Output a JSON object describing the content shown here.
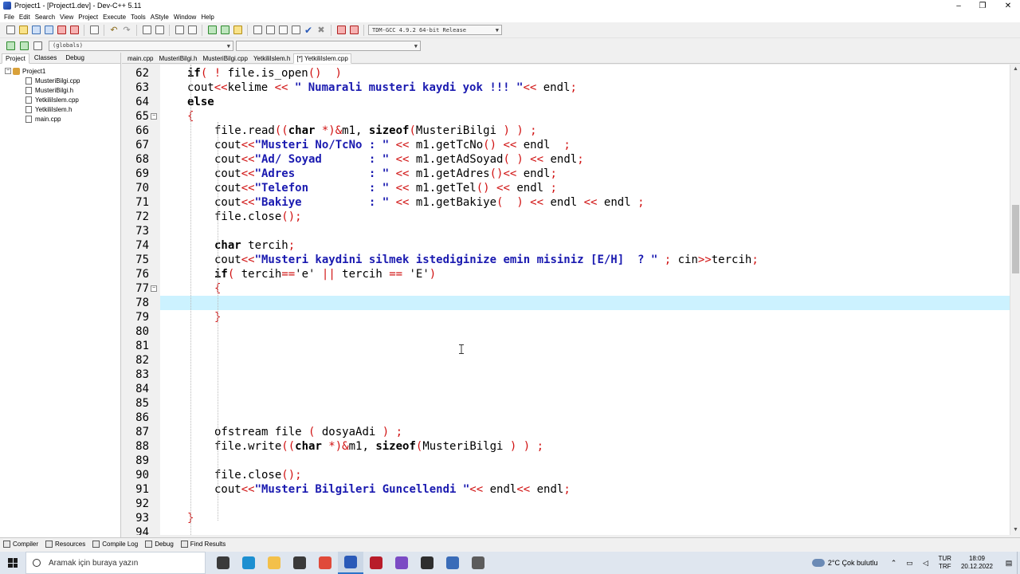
{
  "window": {
    "title": "Project1 - [Project1.dev] - Dev-C++ 5.11",
    "controls": {
      "minimize": "–",
      "maximize": "❐",
      "close": "✕"
    }
  },
  "menu": [
    "File",
    "Edit",
    "Search",
    "View",
    "Project",
    "Execute",
    "Tools",
    "AStyle",
    "Window",
    "Help"
  ],
  "toolbar": {
    "compiler_select": "TDM-GCC 4.9.2 64-bit Release",
    "scope_select": "(globals)",
    "members_select": ""
  },
  "left_panel": {
    "tabs": [
      "Project",
      "Classes",
      "Debug"
    ],
    "active_tab": "Project",
    "project_name": "Project1",
    "files": [
      "MusteriBilgi.cpp",
      "MusteriBilgi.h",
      "YetkiliIslem.cpp",
      "YetkiliIslem.h",
      "main.cpp"
    ]
  },
  "editor_tabs": [
    {
      "label": "main.cpp",
      "active": false
    },
    {
      "label": "MusteriBilgi.h",
      "active": false
    },
    {
      "label": "MusteriBilgi.cpp",
      "active": false
    },
    {
      "label": "YetkiliIslem.h",
      "active": false
    },
    {
      "label": "[*] YetkiliIslem.cpp",
      "active": true
    }
  ],
  "editor": {
    "current_line": 78,
    "lines": [
      {
        "n": "62",
        "indent": 1,
        "tokens": [
          [
            "kw",
            "if"
          ],
          [
            "sym",
            "( "
          ],
          [
            "sym",
            "!"
          ],
          [
            "plain",
            " file.is_open"
          ],
          [
            "sym",
            "()  )"
          ]
        ]
      },
      {
        "n": "63",
        "indent": 1,
        "tokens": [
          [
            "plain",
            "cout"
          ],
          [
            "sym",
            "<<"
          ],
          [
            "plain",
            "kelime "
          ],
          [
            "sym",
            "<<"
          ],
          [
            "str",
            " \" Numarali musteri kaydi yok !!! \""
          ],
          [
            "sym",
            "<<"
          ],
          [
            "plain",
            " endl"
          ],
          [
            "sym",
            ";"
          ]
        ]
      },
      {
        "n": "64",
        "indent": 1,
        "tokens": [
          [
            "kw",
            "else"
          ]
        ]
      },
      {
        "n": "65",
        "indent": 1,
        "fold": true,
        "tokens": [
          [
            "sym",
            "{"
          ]
        ]
      },
      {
        "n": "66",
        "indent": 2,
        "tokens": [
          [
            "plain",
            "file.read"
          ],
          [
            "sym",
            "(("
          ],
          [
            "kw",
            "char"
          ],
          [
            "sym",
            " *)&"
          ],
          [
            "plain",
            "m1, "
          ],
          [
            "kw",
            "sizeof"
          ],
          [
            "sym",
            "("
          ],
          [
            "plain",
            "MusteriBilgi "
          ],
          [
            "sym",
            ") ) ;"
          ]
        ]
      },
      {
        "n": "67",
        "indent": 2,
        "tokens": [
          [
            "plain",
            "cout"
          ],
          [
            "sym",
            "<<"
          ],
          [
            "str",
            "\"Musteri No/TcNo : \""
          ],
          [
            "sym",
            " <<"
          ],
          [
            "plain",
            " m1.getTcNo"
          ],
          [
            "sym",
            "() <<"
          ],
          [
            "plain",
            " endl  "
          ],
          [
            "sym",
            ";"
          ]
        ]
      },
      {
        "n": "68",
        "indent": 2,
        "tokens": [
          [
            "plain",
            "cout"
          ],
          [
            "sym",
            "<<"
          ],
          [
            "str",
            "\"Ad/ Soyad       : \""
          ],
          [
            "sym",
            " <<"
          ],
          [
            "plain",
            " m1.getAdSoyad"
          ],
          [
            "sym",
            "( ) <<"
          ],
          [
            "plain",
            " endl"
          ],
          [
            "sym",
            ";"
          ]
        ]
      },
      {
        "n": "69",
        "indent": 2,
        "tokens": [
          [
            "plain",
            "cout"
          ],
          [
            "sym",
            "<<"
          ],
          [
            "str",
            "\"Adres           : \""
          ],
          [
            "sym",
            " <<"
          ],
          [
            "plain",
            " m1.getAdres"
          ],
          [
            "sym",
            "()<<"
          ],
          [
            "plain",
            " endl"
          ],
          [
            "sym",
            ";"
          ]
        ]
      },
      {
        "n": "70",
        "indent": 2,
        "tokens": [
          [
            "plain",
            "cout"
          ],
          [
            "sym",
            "<<"
          ],
          [
            "str",
            "\"Telefon         : \""
          ],
          [
            "sym",
            " <<"
          ],
          [
            "plain",
            " m1.getTel"
          ],
          [
            "sym",
            "() <<"
          ],
          [
            "plain",
            " endl "
          ],
          [
            "sym",
            ";"
          ]
        ]
      },
      {
        "n": "71",
        "indent": 2,
        "tokens": [
          [
            "plain",
            "cout"
          ],
          [
            "sym",
            "<<"
          ],
          [
            "str",
            "\"Bakiye          : \""
          ],
          [
            "sym",
            " <<"
          ],
          [
            "plain",
            " m1.getBakiye"
          ],
          [
            "sym",
            "(  ) <<"
          ],
          [
            "plain",
            " endl "
          ],
          [
            "sym",
            "<<"
          ],
          [
            "plain",
            " endl "
          ],
          [
            "sym",
            ";"
          ]
        ]
      },
      {
        "n": "72",
        "indent": 2,
        "tokens": [
          [
            "plain",
            "file.close"
          ],
          [
            "sym",
            "();"
          ]
        ]
      },
      {
        "n": "73",
        "indent": 2,
        "tokens": []
      },
      {
        "n": "74",
        "indent": 2,
        "tokens": [
          [
            "kw",
            "char"
          ],
          [
            "plain",
            " tercih"
          ],
          [
            "sym",
            ";"
          ]
        ]
      },
      {
        "n": "75",
        "indent": 2,
        "tokens": [
          [
            "plain",
            "cout"
          ],
          [
            "sym",
            "<<"
          ],
          [
            "str",
            "\"Musteri kaydini silmek istediginize emin misiniz [E/H]  ? \""
          ],
          [
            "sym",
            " ;"
          ],
          [
            "plain",
            " cin"
          ],
          [
            "sym",
            ">>"
          ],
          [
            "plain",
            "tercih"
          ],
          [
            "sym",
            ";"
          ]
        ]
      },
      {
        "n": "76",
        "indent": 2,
        "tokens": [
          [
            "kw",
            "if"
          ],
          [
            "sym",
            "("
          ],
          [
            "plain",
            " tercih"
          ],
          [
            "sym",
            "=="
          ],
          [
            "plain",
            "'e' "
          ],
          [
            "sym",
            "||"
          ],
          [
            "plain",
            " tercih "
          ],
          [
            "sym",
            "=="
          ],
          [
            "plain",
            " 'E'"
          ],
          [
            "sym",
            ")"
          ]
        ]
      },
      {
        "n": "77",
        "indent": 2,
        "fold": true,
        "tokens": [
          [
            "sym",
            "{"
          ]
        ]
      },
      {
        "n": "78",
        "indent": 2,
        "tokens": []
      },
      {
        "n": "79",
        "indent": 2,
        "tokens": [
          [
            "sym",
            "}"
          ]
        ]
      },
      {
        "n": "80",
        "indent": 2,
        "tokens": []
      },
      {
        "n": "81",
        "indent": 2,
        "tokens": []
      },
      {
        "n": "82",
        "indent": 2,
        "tokens": []
      },
      {
        "n": "83",
        "indent": 2,
        "tokens": []
      },
      {
        "n": "84",
        "indent": 2,
        "tokens": []
      },
      {
        "n": "85",
        "indent": 2,
        "tokens": []
      },
      {
        "n": "86",
        "indent": 2,
        "tokens": []
      },
      {
        "n": "87",
        "indent": 2,
        "tokens": [
          [
            "plain",
            "ofstream file "
          ],
          [
            "sym",
            "("
          ],
          [
            "plain",
            " dosyaAdi "
          ],
          [
            "sym",
            ") ;"
          ]
        ]
      },
      {
        "n": "88",
        "indent": 2,
        "tokens": [
          [
            "plain",
            "file.write"
          ],
          [
            "sym",
            "(("
          ],
          [
            "kw",
            "char"
          ],
          [
            "sym",
            " *)&"
          ],
          [
            "plain",
            "m1, "
          ],
          [
            "kw",
            "sizeof"
          ],
          [
            "sym",
            "("
          ],
          [
            "plain",
            "MusteriBilgi "
          ],
          [
            "sym",
            ") ) ;"
          ]
        ]
      },
      {
        "n": "89",
        "indent": 2,
        "tokens": []
      },
      {
        "n": "90",
        "indent": 2,
        "tokens": [
          [
            "plain",
            "file.close"
          ],
          [
            "sym",
            "();"
          ]
        ]
      },
      {
        "n": "91",
        "indent": 2,
        "tokens": [
          [
            "plain",
            "cout"
          ],
          [
            "sym",
            "<<"
          ],
          [
            "str",
            "\"Musteri Bilgileri Guncellendi \""
          ],
          [
            "sym",
            "<<"
          ],
          [
            "plain",
            " endl"
          ],
          [
            "sym",
            "<<"
          ],
          [
            "plain",
            " endl"
          ],
          [
            "sym",
            ";"
          ]
        ]
      },
      {
        "n": "92",
        "indent": 2,
        "tokens": []
      },
      {
        "n": "93",
        "indent": 1,
        "tokens": [
          [
            "sym",
            "}"
          ]
        ]
      },
      {
        "n": "94",
        "indent": 1,
        "tokens": []
      }
    ]
  },
  "bottom_tabs": [
    "Compiler",
    "Resources",
    "Compile Log",
    "Debug",
    "Find Results"
  ],
  "taskbar": {
    "search_placeholder": "Aramak için buraya yazın",
    "weather": "2°C  Çok bulutlu",
    "language_top": "TUR",
    "language_bottom": "TRF",
    "time": "18:09",
    "date": "20.12.2022",
    "apps": [
      {
        "name": "task-view-icon",
        "color": "#3a3a3a",
        "active": false
      },
      {
        "name": "edge-icon",
        "color": "#1c8fd1",
        "active": false
      },
      {
        "name": "file-explorer-icon",
        "color": "#f3c04a",
        "active": false
      },
      {
        "name": "store-icon",
        "color": "#3a3a3a",
        "active": false
      },
      {
        "name": "chrome-icon",
        "color": "#e04a3a",
        "active": false
      },
      {
        "name": "devcpp-icon",
        "color": "#2a5ab8",
        "active": true
      },
      {
        "name": "recorder-icon",
        "color": "#b81c2a",
        "active": false
      },
      {
        "name": "visual-studio-icon",
        "color": "#7b4bc4",
        "active": false
      },
      {
        "name": "terminal-icon",
        "color": "#2e2e2e",
        "active": false
      },
      {
        "name": "network-app-icon",
        "color": "#3a6cb8",
        "active": false
      },
      {
        "name": "tools-icon",
        "color": "#5c5c5c",
        "active": false
      }
    ]
  },
  "colors": {
    "keyword": "#000000",
    "symbol": "#d01010",
    "string": "#1a1ab0",
    "current_line": "#ccf2ff",
    "gutter": "#f0f0f0"
  }
}
